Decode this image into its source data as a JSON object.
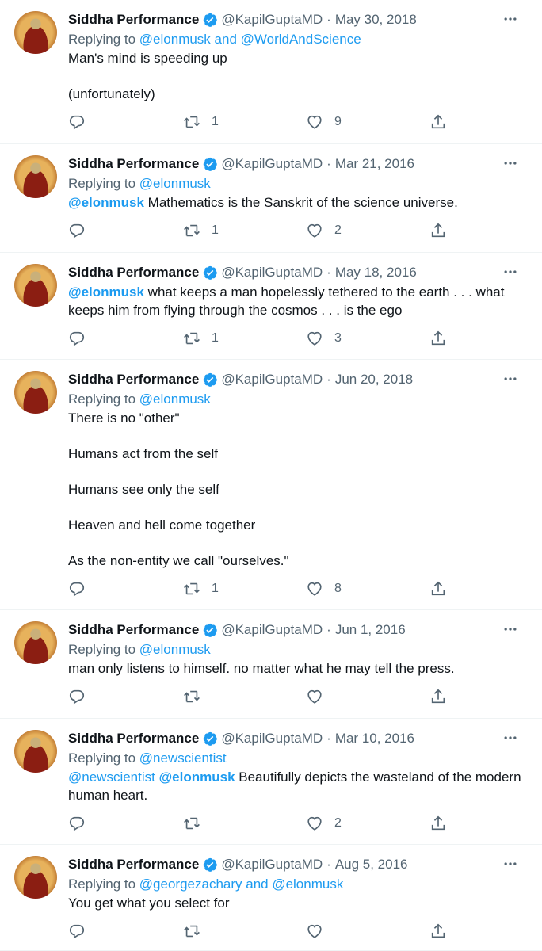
{
  "tweets": [
    {
      "name": "Siddha Performance",
      "handle": "@KapilGuptaMD",
      "date": "May 30, 2018",
      "reply_prefix": "Replying to",
      "reply_links": "@elonmusk and @WorldAndScience",
      "mention": "",
      "paragraphs": [
        "Man's mind is speeding up",
        "(unfortunately)"
      ],
      "retweets": "1",
      "likes": "9"
    },
    {
      "name": "Siddha Performance",
      "handle": "@KapilGuptaMD",
      "date": "Mar 21, 2016",
      "reply_prefix": "Replying to",
      "reply_links": "@elonmusk",
      "mention": "@elonmusk",
      "paragraphs": [
        " Mathematics is the Sanskrit of the science universe."
      ],
      "retweets": "1",
      "likes": "2"
    },
    {
      "name": "Siddha Performance",
      "handle": "@KapilGuptaMD",
      "date": "May 18, 2016",
      "reply_prefix": "",
      "reply_links": "",
      "mention": "@elonmusk",
      "paragraphs": [
        " what keeps a man hopelessly tethered to the earth . . . what keeps him from flying through the cosmos . . . is the ego"
      ],
      "retweets": "1",
      "likes": "3"
    },
    {
      "name": "Siddha Performance",
      "handle": "@KapilGuptaMD",
      "date": "Jun 20, 2018",
      "reply_prefix": "Replying to",
      "reply_links": "@elonmusk",
      "mention": "",
      "paragraphs": [
        "There is no \"other\"",
        "Humans act from the self",
        "Humans see only the self",
        "Heaven and hell come together",
        "As the non-entity we call \"ourselves.\""
      ],
      "retweets": "1",
      "likes": "8"
    },
    {
      "name": "Siddha Performance",
      "handle": "@KapilGuptaMD",
      "date": "Jun 1, 2016",
      "reply_prefix": "Replying to",
      "reply_links": "@elonmusk",
      "mention": "",
      "paragraphs": [
        "man only listens to himself. no matter what he may tell the press."
      ],
      "retweets": "",
      "likes": ""
    },
    {
      "name": "Siddha Performance",
      "handle": "@KapilGuptaMD",
      "date": "Mar 10, 2016",
      "reply_prefix": "Replying to",
      "reply_links": "@newscientist",
      "mention": "",
      "mention_plain": "@newscientist",
      "mention_bold": "@elonmusk",
      "paragraphs": [
        " Beautifully depicts the wasteland of the modern human heart."
      ],
      "retweets": "",
      "likes": "2"
    },
    {
      "name": "Siddha Performance",
      "handle": "@KapilGuptaMD",
      "date": "Aug 5, 2016",
      "reply_prefix": "Replying to",
      "reply_links": "@georgezachary and @elonmusk",
      "mention": "",
      "paragraphs": [
        "You get what you select for"
      ],
      "retweets": "",
      "likes": ""
    }
  ],
  "colors": {
    "link": "#1d9bf0",
    "muted": "#536471",
    "text": "#0f1419",
    "verified": "#1d9bf0"
  },
  "icons": {
    "verified": "verified-badge-icon",
    "more": "more-icon",
    "reply": "reply-icon",
    "retweet": "retweet-icon",
    "like": "like-icon",
    "share": "share-icon"
  }
}
